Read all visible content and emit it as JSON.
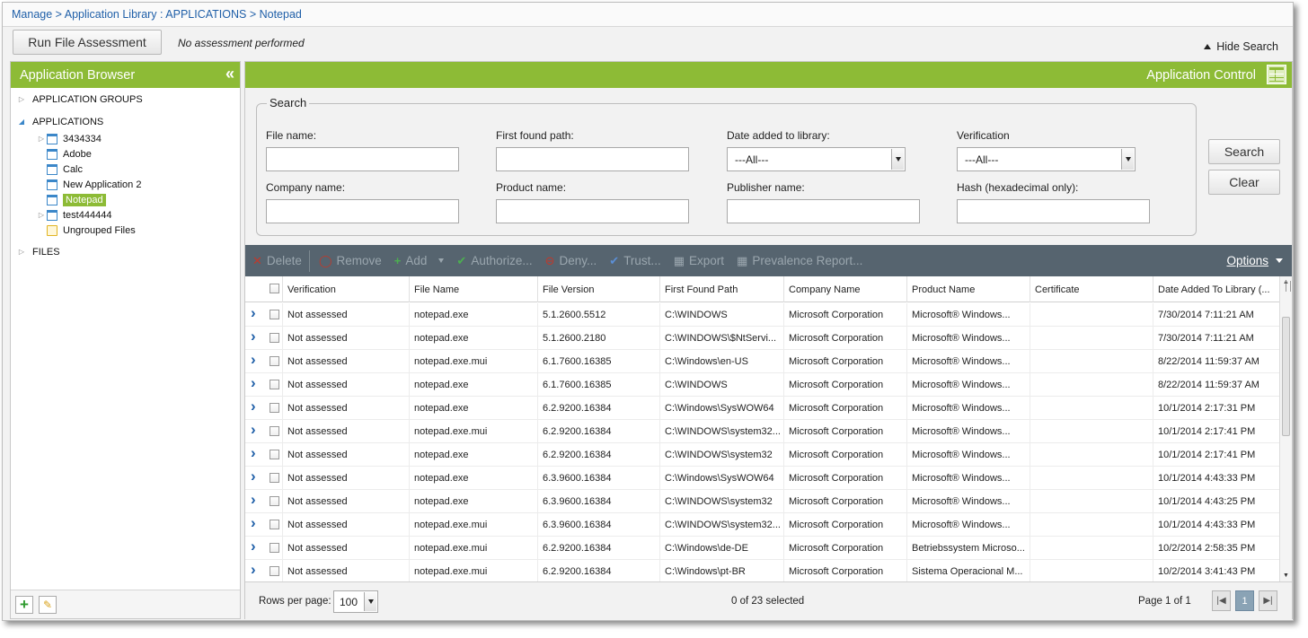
{
  "breadcrumb": "Manage > Application Library : APPLICATIONS > Notepad",
  "top": {
    "run_button": "Run File Assessment",
    "assessment_status": "No assessment performed",
    "hide_search": "Hide Search"
  },
  "browser": {
    "title": "Application Browser",
    "tree": [
      {
        "label": "APPLICATION GROUPS",
        "type": "group",
        "expander": "collapsed"
      },
      {
        "label": "APPLICATIONS",
        "type": "group",
        "expander": "expanded"
      },
      {
        "label": "3434334",
        "type": "app",
        "expander": "collapsed"
      },
      {
        "label": "Adobe",
        "type": "app",
        "expander": "none"
      },
      {
        "label": "Calc",
        "type": "app",
        "expander": "none"
      },
      {
        "label": "New Application 2",
        "type": "app",
        "expander": "none"
      },
      {
        "label": "Notepad",
        "type": "app",
        "expander": "none",
        "selected": true
      },
      {
        "label": "test444444",
        "type": "app",
        "expander": "collapsed"
      },
      {
        "label": "Ungrouped Files",
        "type": "folder",
        "expander": "none"
      },
      {
        "label": "FILES",
        "type": "group",
        "expander": "collapsed"
      }
    ]
  },
  "control": {
    "title": "Application Control"
  },
  "search": {
    "legend": "Search",
    "file_name_label": "File name:",
    "first_found_path_label": "First found path:",
    "date_added_label": "Date added to library:",
    "date_added_value": "---All---",
    "verification_label": "Verification",
    "verification_value": "---All---",
    "company_name_label": "Company name:",
    "product_name_label": "Product name:",
    "publisher_name_label": "Publisher name:",
    "hash_label": "Hash (hexadecimal only):",
    "search_button": "Search",
    "clear_button": "Clear"
  },
  "toolbar": {
    "delete": "Delete",
    "remove": "Remove",
    "add": "Add",
    "authorize": "Authorize...",
    "deny": "Deny...",
    "trust": "Trust...",
    "export": "Export",
    "prevalence": "Prevalence Report...",
    "options": "Options"
  },
  "table": {
    "columns": [
      "Verification",
      "File Name",
      "File Version",
      "First Found Path",
      "Company Name",
      "Product Name",
      "Certificate",
      "Date Added To Library (..."
    ],
    "rows": [
      [
        "Not assessed",
        "notepad.exe",
        "5.1.2600.5512",
        "C:\\WINDOWS",
        "Microsoft Corporation",
        "Microsoft® Windows...",
        "",
        "7/30/2014 7:11:21 AM"
      ],
      [
        "Not assessed",
        "notepad.exe",
        "5.1.2600.2180",
        "C:\\WINDOWS\\$NtServi...",
        "Microsoft Corporation",
        "Microsoft® Windows...",
        "",
        "7/30/2014 7:11:21 AM"
      ],
      [
        "Not assessed",
        "notepad.exe.mui",
        "6.1.7600.16385",
        "C:\\Windows\\en-US",
        "Microsoft Corporation",
        "Microsoft® Windows...",
        "",
        "8/22/2014 11:59:37 AM"
      ],
      [
        "Not assessed",
        "notepad.exe",
        "6.1.7600.16385",
        "C:\\WINDOWS",
        "Microsoft Corporation",
        "Microsoft® Windows...",
        "",
        "8/22/2014 11:59:37 AM"
      ],
      [
        "Not assessed",
        "notepad.exe",
        "6.2.9200.16384",
        "C:\\Windows\\SysWOW64",
        "Microsoft Corporation",
        "Microsoft® Windows...",
        "",
        "10/1/2014 2:17:31 PM"
      ],
      [
        "Not assessed",
        "notepad.exe.mui",
        "6.2.9200.16384",
        "C:\\WINDOWS\\system32...",
        "Microsoft Corporation",
        "Microsoft® Windows...",
        "",
        "10/1/2014 2:17:41 PM"
      ],
      [
        "Not assessed",
        "notepad.exe",
        "6.2.9200.16384",
        "C:\\WINDOWS\\system32",
        "Microsoft Corporation",
        "Microsoft® Windows...",
        "",
        "10/1/2014 2:17:41 PM"
      ],
      [
        "Not assessed",
        "notepad.exe",
        "6.3.9600.16384",
        "C:\\Windows\\SysWOW64",
        "Microsoft Corporation",
        "Microsoft® Windows...",
        "",
        "10/1/2014 4:43:33 PM"
      ],
      [
        "Not assessed",
        "notepad.exe",
        "6.3.9600.16384",
        "C:\\WINDOWS\\system32",
        "Microsoft Corporation",
        "Microsoft® Windows...",
        "",
        "10/1/2014 4:43:25 PM"
      ],
      [
        "Not assessed",
        "notepad.exe.mui",
        "6.3.9600.16384",
        "C:\\WINDOWS\\system32...",
        "Microsoft Corporation",
        "Microsoft® Windows...",
        "",
        "10/1/2014 4:43:33 PM"
      ],
      [
        "Not assessed",
        "notepad.exe.mui",
        "6.2.9200.16384",
        "C:\\Windows\\de-DE",
        "Microsoft Corporation",
        "Betriebssystem Microso...",
        "",
        "10/2/2014 2:58:35 PM"
      ],
      [
        "Not assessed",
        "notepad.exe.mui",
        "6.2.9200.16384",
        "C:\\Windows\\pt-BR",
        "Microsoft Corporation",
        "Sistema Operacional M...",
        "",
        "10/2/2014 3:41:43 PM"
      ]
    ]
  },
  "footer": {
    "rows_per_page_label": "Rows per page:",
    "rows_per_page_value": "100",
    "selection_count": "0 of 23 selected",
    "page_info": "Page 1 of 1",
    "current_page": "1"
  },
  "colors": {
    "accent_green": "#8dbb36",
    "toolbar_bg": "#56646f",
    "link_blue": "#1f5fa8"
  }
}
